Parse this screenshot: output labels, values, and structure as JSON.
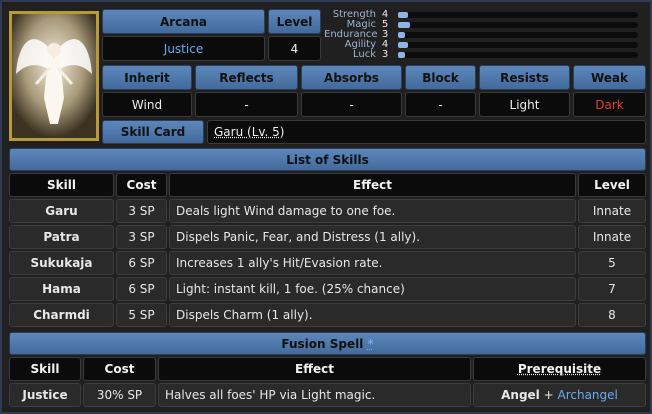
{
  "header": {
    "arcana_label": "Arcana",
    "arcana_value": "Justice",
    "level_label": "Level",
    "level_value": "4"
  },
  "stats": [
    {
      "label": "Strength",
      "value": "4",
      "fraction": 0.04
    },
    {
      "label": "Magic",
      "value": "5",
      "fraction": 0.05
    },
    {
      "label": "Endurance",
      "value": "3",
      "fraction": 0.03
    },
    {
      "label": "Agility",
      "value": "4",
      "fraction": 0.04
    },
    {
      "label": "Luck",
      "value": "3",
      "fraction": 0.03
    }
  ],
  "affinities": {
    "headers": [
      "Inherit",
      "Reflects",
      "Absorbs",
      "Block",
      "Resists",
      "Weak"
    ],
    "values": [
      "Wind",
      "-",
      "-",
      "-",
      "Light",
      "Dark"
    ],
    "colors": {
      "weak": "#e23b3b"
    }
  },
  "skill_card": {
    "label": "Skill Card",
    "value": "Garu (Lv. 5)"
  },
  "skills": {
    "title": "List of Skills",
    "columns": [
      "Skill",
      "Cost",
      "Effect",
      "Level"
    ],
    "rows": [
      {
        "skill": "Garu",
        "cost": "3 SP",
        "effect": "Deals light Wind damage to one foe.",
        "level": "Innate"
      },
      {
        "skill": "Patra",
        "cost": "3 SP",
        "effect": "Dispels Panic, Fear, and Distress (1 ally).",
        "level": "Innate"
      },
      {
        "skill": "Sukukaja",
        "cost": "6 SP",
        "effect": "Increases 1 ally's Hit/Evasion rate.",
        "level": "5"
      },
      {
        "skill": "Hama",
        "cost": "6 SP",
        "effect": "Light: instant kill, 1 foe. (25% chance)",
        "level": "7"
      },
      {
        "skill": "Charmdi",
        "cost": "5 SP",
        "effect": "Dispels Charm (1 ally).",
        "level": "8"
      }
    ]
  },
  "fusion": {
    "title": "Fusion Spell",
    "title_mark": "*",
    "columns": [
      "Skill",
      "Cost",
      "Effect",
      "Prerequisite"
    ],
    "row": {
      "skill": "Justice",
      "cost": "30% SP",
      "effect": "Halves all foes' HP via Light magic.",
      "prereq_a": "Angel",
      "prereq_join": " + ",
      "prereq_b": "Archangel"
    }
  }
}
